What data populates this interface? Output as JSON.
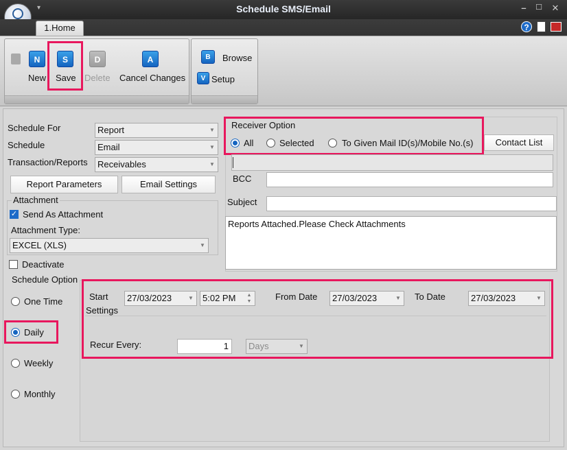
{
  "window": {
    "title": "Schedule SMS/Email",
    "minimize": "–",
    "maximize": "☐",
    "close": "✕"
  },
  "ribbon": {
    "tab": "1.Home",
    "buttons": {
      "new": "New",
      "save": "Save",
      "delete": "Delete",
      "cancel": "Cancel Changes",
      "browse": "Browse",
      "setup": "Setup"
    },
    "icon_glyphs": {
      "new": "N",
      "save": "S",
      "delete": "D",
      "cancel": "A",
      "browse": "B",
      "setup": "V"
    }
  },
  "form": {
    "schedule_for": {
      "label": "Schedule For",
      "value": "Report"
    },
    "schedule": {
      "label": "Schedule",
      "value": "Email"
    },
    "transaction": {
      "label": "Transaction/Reports",
      "value": "Receivables"
    },
    "report_parameters": "Report Parameters",
    "email_settings": "Email Settings",
    "attachment": {
      "group_label": "Attachment",
      "send_as_attachment": "Send As Attachment",
      "type_label": "Attachment Type:",
      "type_value": "EXCEL (XLS)"
    },
    "deactivate": "Deactivate",
    "receiver": {
      "group_label": "Receiver Option",
      "options": [
        "All",
        "Selected",
        "To Given Mail ID(s)/Mobile No.(s)"
      ],
      "selected": "All",
      "contact_list": "Contact List"
    },
    "bcc_label": "BCC",
    "subject_label": "Subject",
    "body": "Reports Attached.Please Check Attachments",
    "schedule_option": {
      "group_label": "Schedule Option",
      "options": [
        "One Time",
        "Daily",
        "Weekly",
        "Monthly"
      ],
      "selected": "Daily"
    },
    "timing": {
      "start_label": "Start",
      "start_date": "27/03/2023",
      "start_time": "5:02 PM",
      "from_label": "From Date",
      "from_date": "27/03/2023",
      "to_label": "To Date",
      "to_date": "27/03/2023",
      "settings_label": "Settings",
      "recur_label": "Recur Every:",
      "recur_value": "1",
      "recur_unit": "Days"
    }
  },
  "colors": {
    "highlight": "#e8175d",
    "accent": "#1565c0"
  }
}
